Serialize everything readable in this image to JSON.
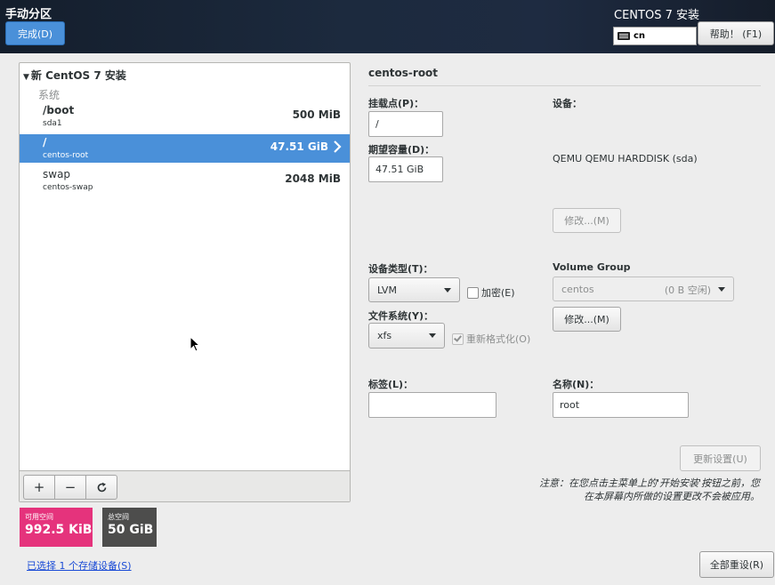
{
  "header": {
    "page_title": "手动分区",
    "done_button": "完成(D)",
    "product_title": "CENTOS 7 安装",
    "keyboard_layout": "cn",
    "help_button": "帮助！ (F1)"
  },
  "tree": {
    "install_title": "新 CentOS 7 安装",
    "section_label": "系统",
    "partitions": [
      {
        "name": "/boot",
        "device": "sda1",
        "size": "500 MiB"
      },
      {
        "name": "/",
        "device": "centos-root",
        "size": "47.51 GiB"
      },
      {
        "name": "swap",
        "device": "centos-swap",
        "size": "2048 MiB"
      }
    ],
    "toolbar": {
      "add": "+",
      "remove": "−",
      "refresh": "↻"
    }
  },
  "space": {
    "available_label": "可用空间",
    "available_value": "992.5 KiB",
    "total_label": "总空间",
    "total_value": "50 GiB"
  },
  "storage_link": "已选择 1 个存储设备(S)",
  "reset_button": "全部重设(R)",
  "detail": {
    "title": "centos-root",
    "mount_point_label": "挂载点(P)：",
    "mount_point_value": "/",
    "desired_capacity_label": "期望容量(D)：",
    "desired_capacity_value": "47.51 GiB",
    "device_label": "设备：",
    "device_name": "QEMU QEMU HARDDISK (sda)",
    "modify_button_disabled": "修改...(M)",
    "device_type_label": "设备类型(T)：",
    "device_type_value": "LVM",
    "encrypt_label": "加密(E)",
    "volume_group_label": "Volume Group",
    "volume_group_value": "centos",
    "volume_group_free": "(0 B 空闲)",
    "modify_button": "修改...(M)",
    "filesystem_label": "文件系统(Y)：",
    "filesystem_value": "xfs",
    "reformat_label": "重新格式化(O)",
    "tag_label": "标签(L)：",
    "tag_value": "",
    "name_label": "名称(N)：",
    "name_value": "root",
    "update_button": "更新设置(U)",
    "note_line1": "注意：在您点击主菜单上的'开始安装'按钮之前，您",
    "note_line2": "在本屏幕内所做的设置更改不会被应用。"
  }
}
